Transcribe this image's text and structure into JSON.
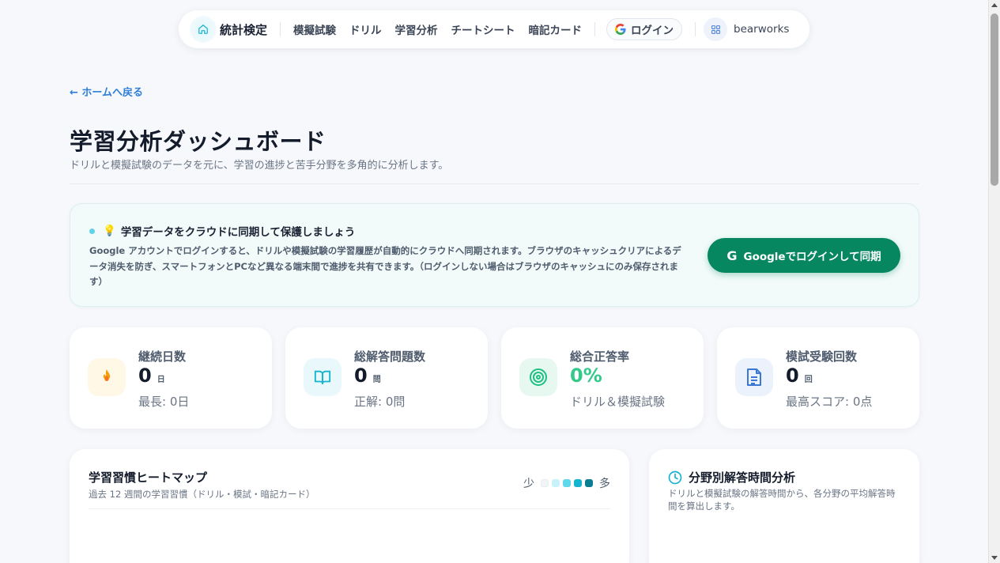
{
  "nav": {
    "brand": "統計検定",
    "links": [
      "模擬試験",
      "ドリル",
      "学習分析",
      "チートシート",
      "暗記カード"
    ],
    "login_label": "ログイン",
    "user_label": "bearworks"
  },
  "back_link": "← ホームへ戻る",
  "page": {
    "title": "学習分析ダッシュボード",
    "subtitle": "ドリルと模擬試験のデータを元に、学習の進捗と苦手分野を多角的に分析します。"
  },
  "sync": {
    "title": "学習データをクラウドに同期して保護しましょう",
    "description": "Google アカウントでログインすると、ドリルや模擬試験の学習履歴が自動的にクラウドへ同期されます。ブラウザのキャッシュクリアによるデータ消失を防ぎ、スマートフォンとPCなど異なる端末間で進捗を共有できます。（ログインしない場合はブラウザのキャッシュにのみ保存されます）",
    "button_label": "Googleでログインして同期"
  },
  "stats": [
    {
      "label": "継続日数",
      "value": "0",
      "unit": "日",
      "sub": "最長: 0日",
      "icon": "fire-icon",
      "icon_bg": "#fff8e6"
    },
    {
      "label": "総解答問題数",
      "value": "0",
      "unit": "問",
      "sub": "正解: 0問",
      "icon": "book-icon",
      "icon_bg": "#e8f8fb"
    },
    {
      "label": "総合正答率",
      "value": "0%",
      "unit": "",
      "sub": "ドリル＆模擬試験",
      "icon": "target-icon",
      "icon_bg": "#e7f8f1",
      "value_color": "#34c98a"
    },
    {
      "label": "模試受験回数",
      "value": "0",
      "unit": "回",
      "sub": "最高スコア: 0点",
      "icon": "document-icon",
      "icon_bg": "#ecf2fc"
    }
  ],
  "heatmap": {
    "title": "学習習慣ヒートマップ",
    "subtitle": "過去 12 週間の学習習慣（ドリル・模試・暗記カード）",
    "legend_low": "少",
    "legend_high": "多",
    "legend_colors": [
      "#f2f5f8",
      "#c7f2f9",
      "#5fd8ec",
      "#14b3cf",
      "#0b7d92"
    ]
  },
  "time_analysis": {
    "title": "分野別解答時間分析",
    "subtitle": "ドリルと模擬試験の解答時間から、各分野の平均解答時間を算出します。"
  },
  "colors": {
    "accent": "#2f7ed8",
    "sync_button": "#07875f",
    "teal": "#14b3cf"
  }
}
